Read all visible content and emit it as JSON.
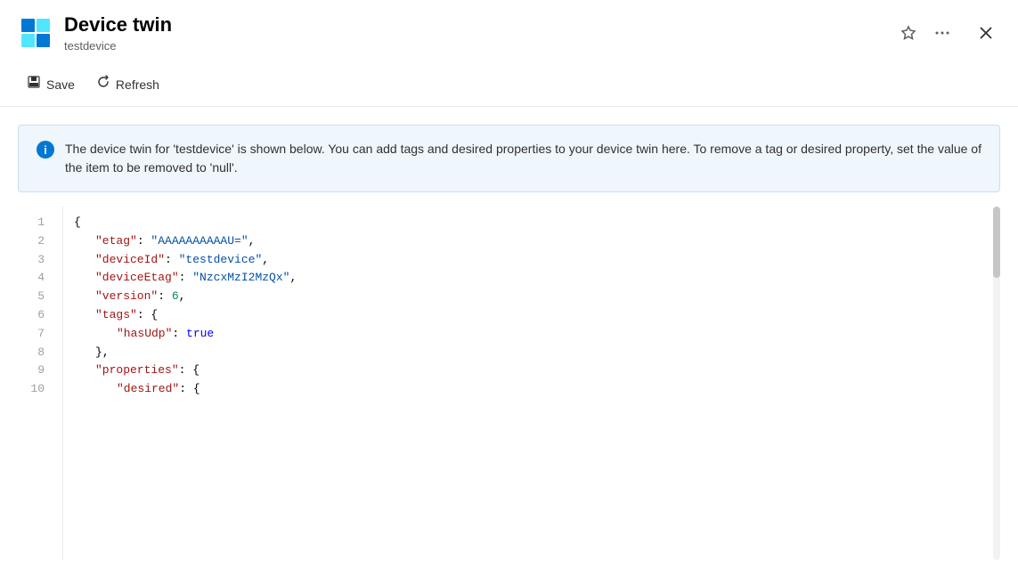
{
  "header": {
    "title": "Device twin",
    "subtitle": "testdevice",
    "pin_label": "📌",
    "more_label": "···",
    "close_label": "✕"
  },
  "toolbar": {
    "save_label": "Save",
    "refresh_label": "Refresh"
  },
  "info_banner": {
    "text": "The device twin for 'testdevice' is shown below. You can add tags and desired properties to your device twin here. To remove a tag or desired property, set the value of the item to be removed to 'null'."
  },
  "code": {
    "lines": [
      {
        "num": "1",
        "content": "{"
      },
      {
        "num": "2",
        "content": "    \"etag\": \"AAAAAAAAAAU=\","
      },
      {
        "num": "3",
        "content": "    \"deviceId\": \"testdevice\","
      },
      {
        "num": "4",
        "content": "    \"deviceEtag\": \"NzcxMzI2MzQx\","
      },
      {
        "num": "5",
        "content": "    \"version\": 6,"
      },
      {
        "num": "6",
        "content": "    \"tags\": {"
      },
      {
        "num": "7",
        "content": "        \"hasUdp\": true"
      },
      {
        "num": "8",
        "content": "    },"
      },
      {
        "num": "9",
        "content": "    \"properties\": {"
      },
      {
        "num": "10",
        "content": "        \"desired\": {"
      }
    ]
  }
}
